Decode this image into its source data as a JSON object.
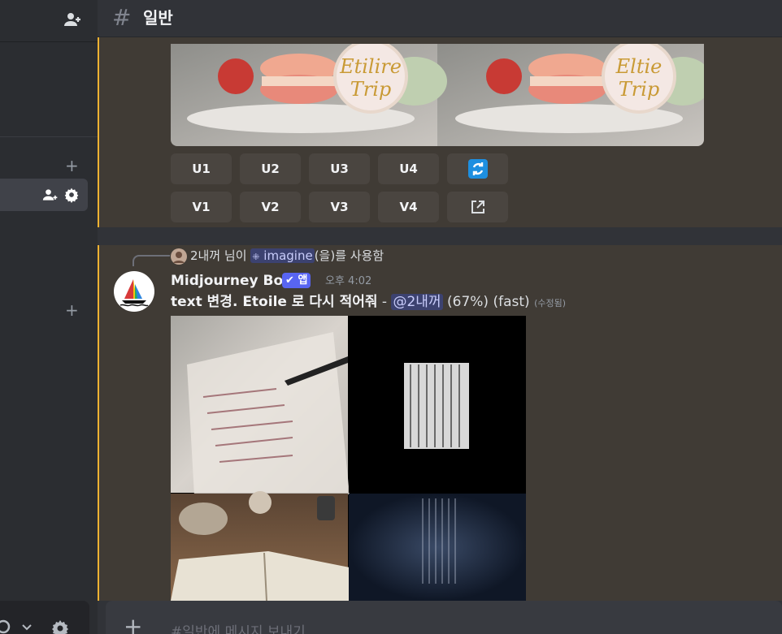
{
  "sidebar": {
    "add_friend_icon": "add-friend-icon",
    "plus_label": "+",
    "channel_icons": [
      "add-member-icon",
      "gear-icon"
    ]
  },
  "channel": {
    "hash": "#",
    "name": "일반"
  },
  "message1": {
    "image_alt": "macaron etoile trip",
    "upscale_buttons": [
      "U1",
      "U2",
      "U3",
      "U4"
    ],
    "variation_buttons": [
      "V1",
      "V2",
      "V3",
      "V4"
    ],
    "reroll_icon": "reroll-icon",
    "open_icon": "external-link-icon"
  },
  "message2": {
    "reply_user": "2내꺼",
    "reply_mid": " 님이 ",
    "reply_command": "imagine",
    "reply_suffix": "(을)를 사용함",
    "author": "Midjourney Bot",
    "app_badge": "앱",
    "timestamp": "오후 4:02",
    "prompt": "text 변경. Etoile 로 다시 적어줘",
    "dash": " - ",
    "mention": "@2내꺼",
    "progress": "(67%)",
    "speed": "(fast)",
    "edited": "(수정됨)"
  },
  "composer": {
    "placeholder": "#일반에 메시지 보내기",
    "plus": "+"
  },
  "colors": {
    "accent": "#f0b232",
    "mention_bg": "#3c4270",
    "mention_fg": "#c9cdfb",
    "link": "#00a8fc"
  }
}
